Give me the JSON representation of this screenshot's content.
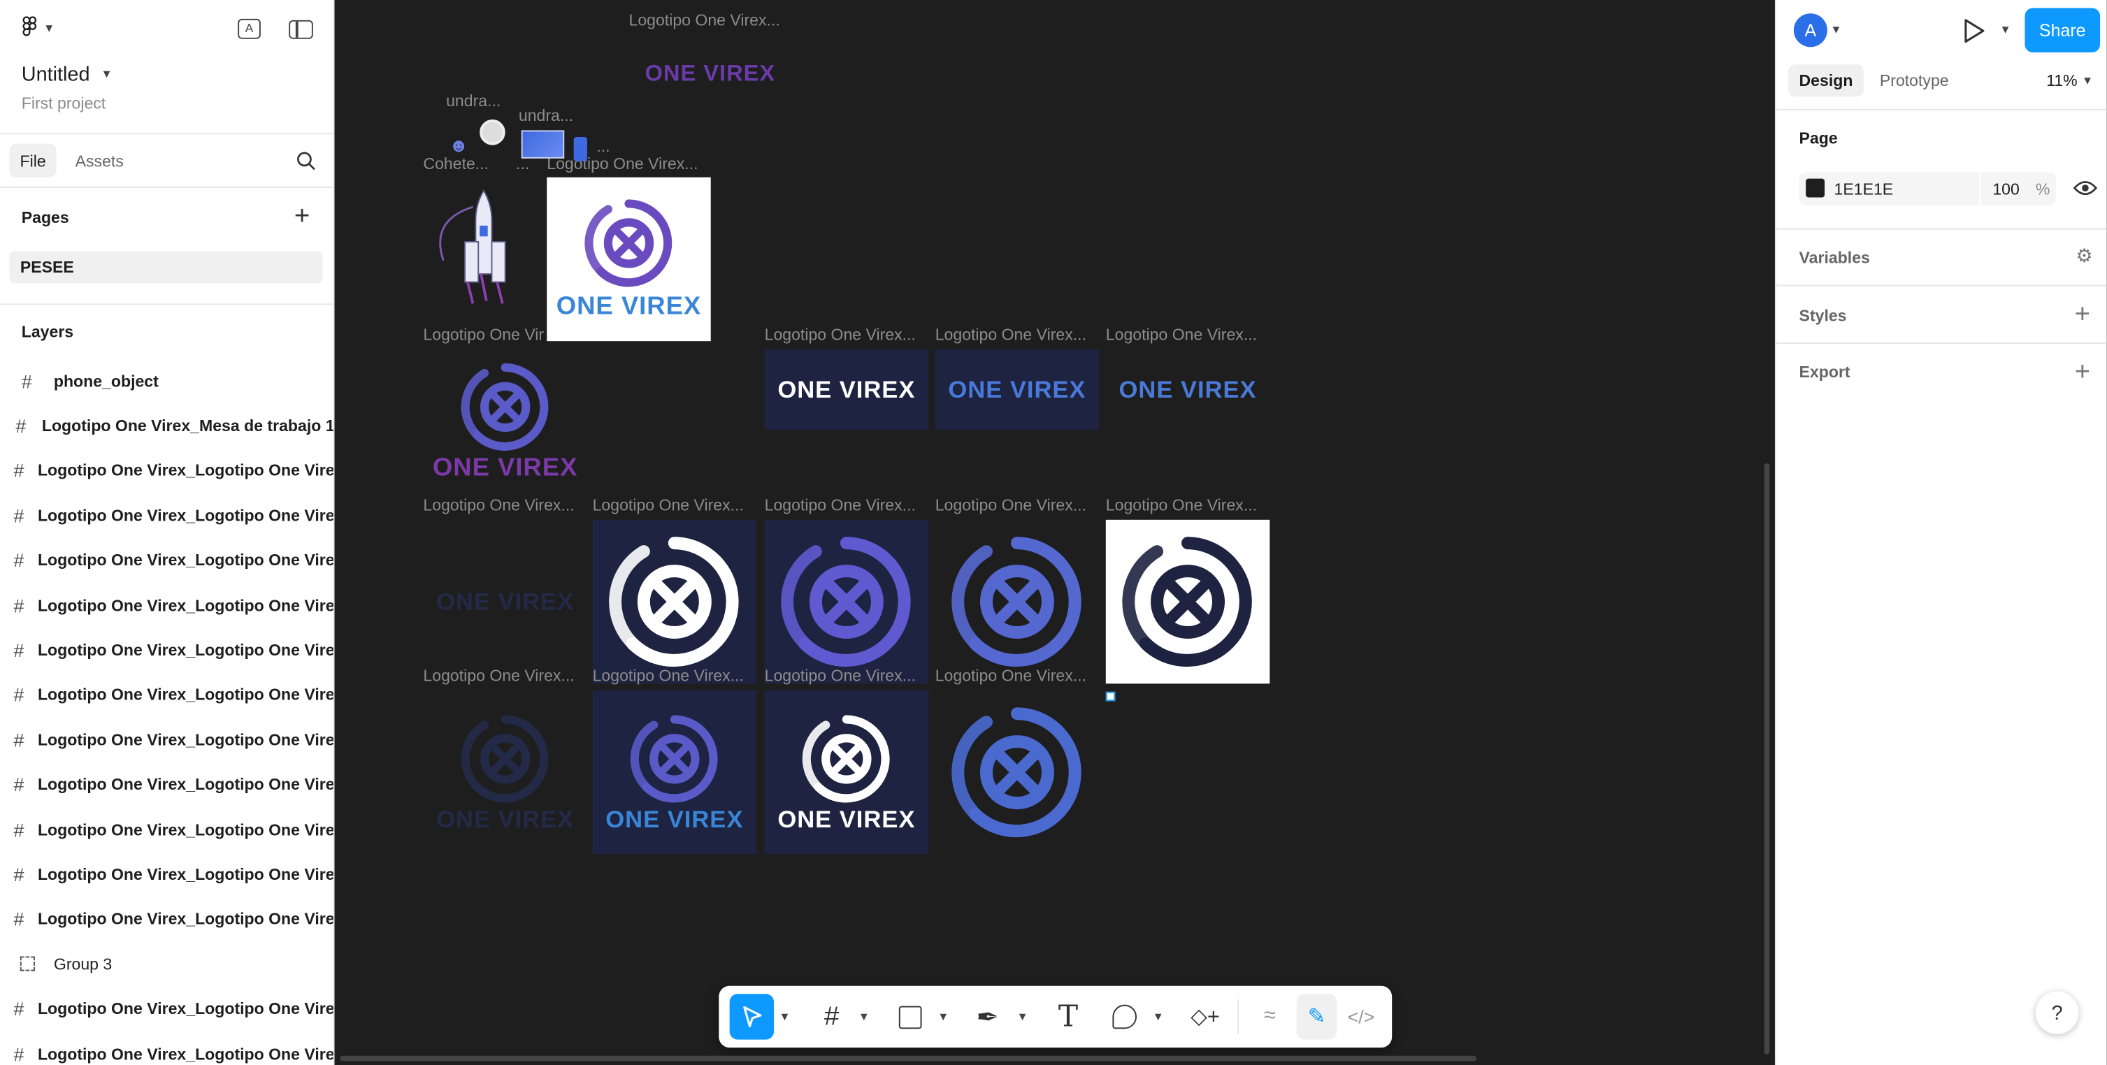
{
  "app": {
    "file_title": "Untitled",
    "project": "First project"
  },
  "left_tabs": [
    "File",
    "Assets"
  ],
  "pages": {
    "title": "Pages",
    "items": [
      "PESEE"
    ]
  },
  "layers": {
    "title": "Layers",
    "items": [
      {
        "label": "phone_object",
        "icon": "frame-icon"
      },
      {
        "label": "Logotipo One Virex_Mesa de trabajo 1",
        "icon": "frame-icon"
      },
      {
        "label": "Logotipo One Virex_Logotipo One Vire",
        "icon": "frame-icon"
      },
      {
        "label": "Logotipo One Virex_Logotipo One Vire",
        "icon": "frame-icon"
      },
      {
        "label": "Logotipo One Virex_Logotipo One Vire",
        "icon": "frame-icon"
      },
      {
        "label": "Logotipo One Virex_Logotipo One Vire",
        "icon": "frame-icon"
      },
      {
        "label": "Logotipo One Virex_Logotipo One Vire",
        "icon": "frame-icon"
      },
      {
        "label": "Logotipo One Virex_Logotipo One Vire",
        "icon": "frame-icon"
      },
      {
        "label": "Logotipo One Virex_Logotipo One Vire",
        "icon": "frame-icon"
      },
      {
        "label": "Logotipo One Virex_Logotipo One Vire",
        "icon": "frame-icon"
      },
      {
        "label": "Logotipo One Virex_Logotipo One Vire",
        "icon": "frame-icon"
      },
      {
        "label": "Logotipo One Virex_Logotipo One Vire",
        "icon": "frame-icon"
      },
      {
        "label": "Logotipo One Virex_Logotipo One Vire",
        "icon": "frame-icon"
      },
      {
        "label": "Group 3",
        "icon": "group-icon"
      },
      {
        "label": "Logotipo One Virex_Logotipo One Vire",
        "icon": "frame-icon"
      },
      {
        "label": "Logotipo One Virex_Logotipo One Vire",
        "icon": "frame-icon"
      }
    ]
  },
  "canvas": {
    "frame_label": "Logotipo One Virex...",
    "frame_label_short": "Logotipo One Vir",
    "undraw_label": "undra...",
    "cohete_label": "Cohete...",
    "ellipsis": "...",
    "wordmark": "ONE VIREX"
  },
  "right": {
    "avatar_letter": "A",
    "share": "Share",
    "tabs": [
      "Design",
      "Prototype"
    ],
    "zoom": "11%",
    "page_section": "Page",
    "page_color": "1E1E1E",
    "page_opacity": "100",
    "percent": "%",
    "sections": [
      "Variables",
      "Styles",
      "Export"
    ]
  },
  "colors": {
    "accent": "#0d99ff",
    "canvas_bg": "#1e1e1e",
    "tile_bg": "#1d2340",
    "logo_blue": "#3a86d6",
    "logo_purple": "#7b3aa8"
  },
  "help": "?"
}
